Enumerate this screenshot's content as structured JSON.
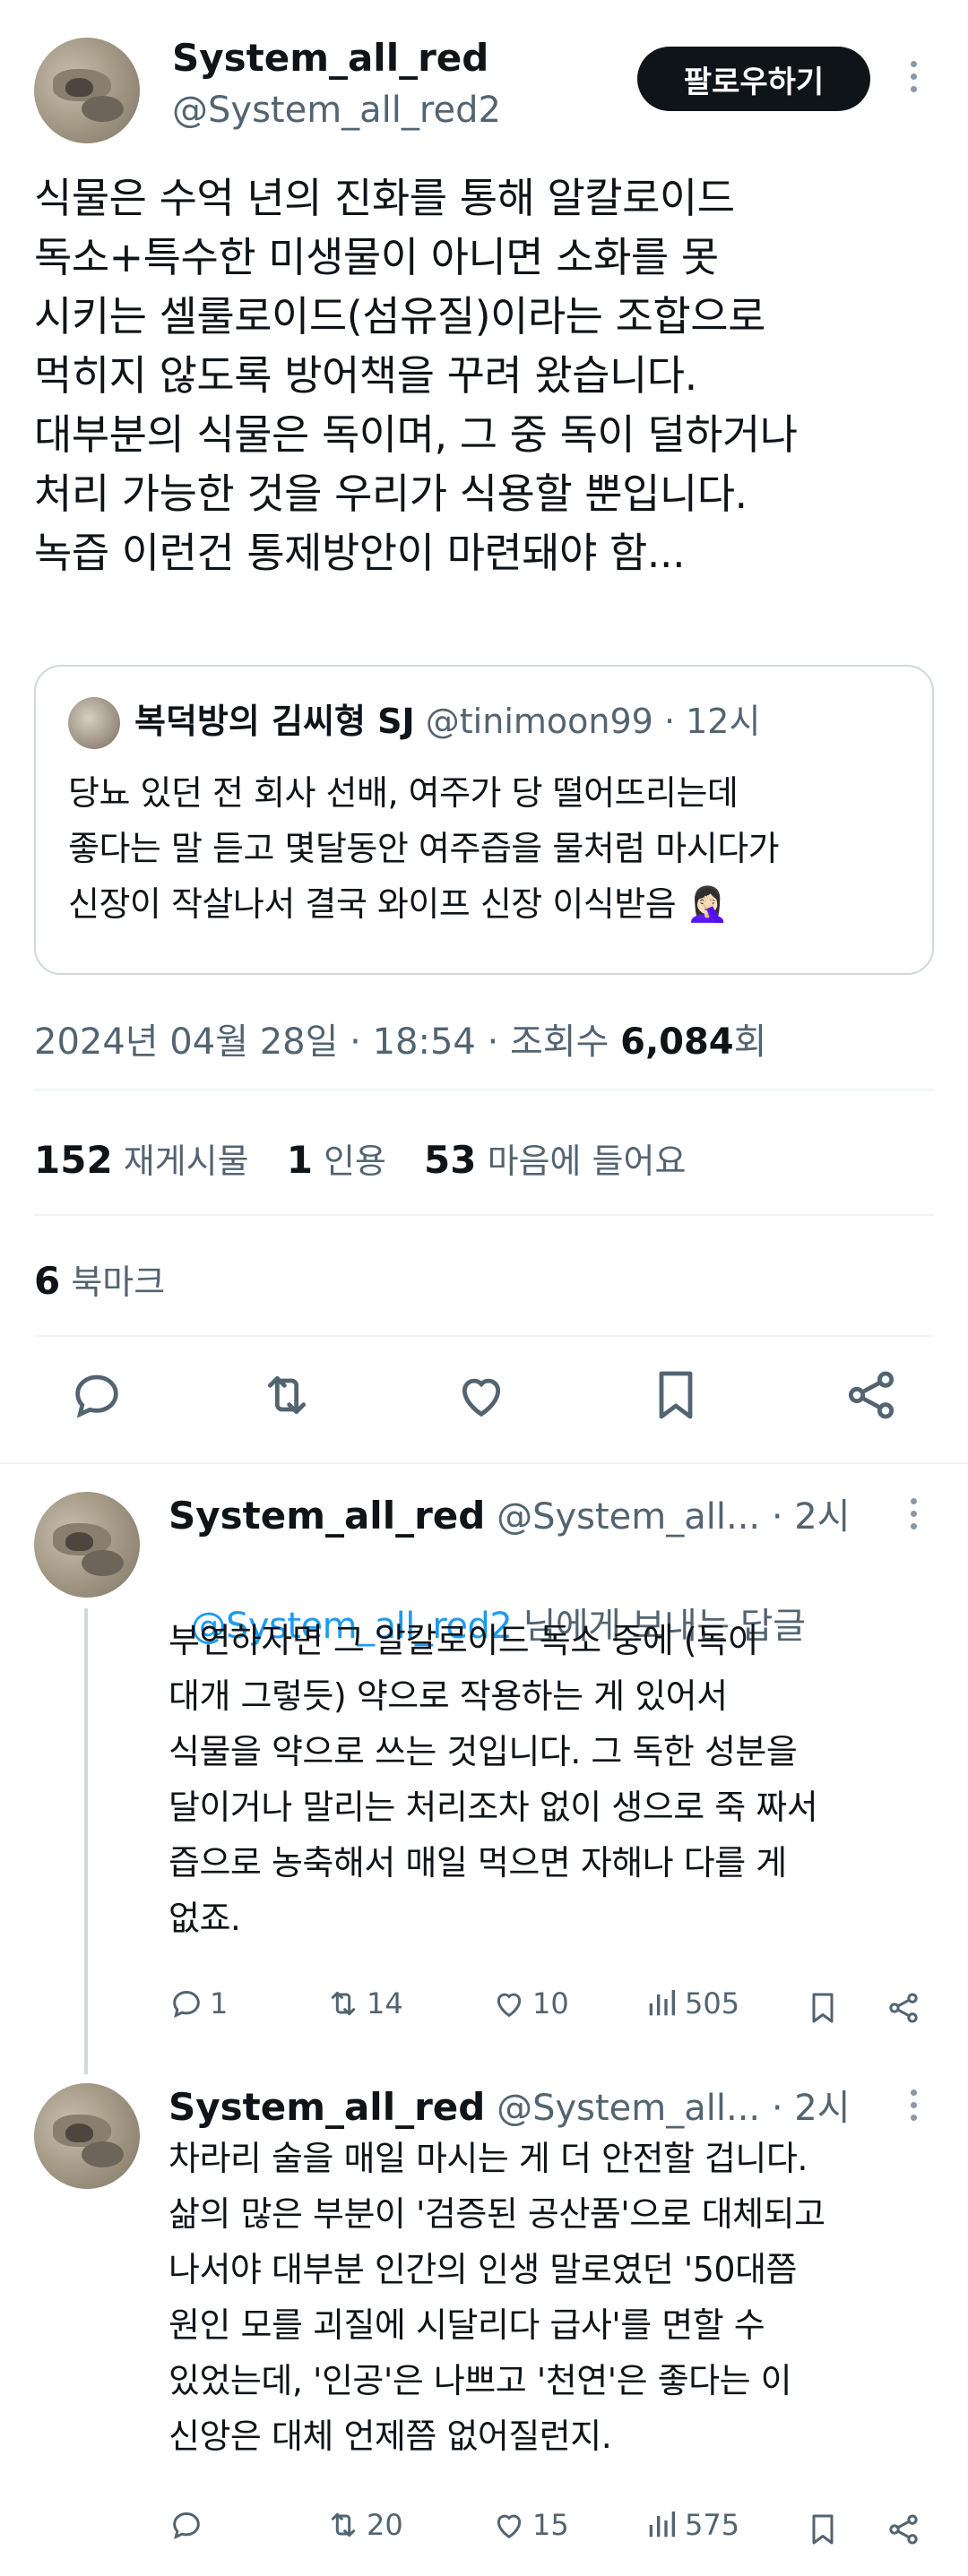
{
  "main": {
    "name": "System_all_red",
    "handle": "@System_all_red2",
    "follow_label": "팔로우하기",
    "text": "식물은 수억 년의 진화를 통해 알칼로이드\n독소+특수한 미생물이 아니면 소화를 못\n시키는 셀룰로이드(섬유질)이라는 조합으로\n먹히지 않도록 방어책을 꾸려 왔습니다.\n대부분의 식물은 독이며, 그 중 독이 덜하거나\n처리 가능한 것을 우리가 식용할 뿐입니다.\n녹즙 이런건 통제방안이 마련돼야 함...",
    "quote": {
      "name": "복덕방의 김씨형 SJ",
      "handle": "@tinimoon99",
      "time": "· 12시",
      "text": "당뇨 있던 전 회사 선배, 여주가 당 떨어뜨리는데\n좋다는 말 듣고 몇달동안 여주즙을 물처럼 마시다가\n신장이 작살나서 결국 와이프 신장 이식받음 🤦🏻‍♀️"
    },
    "date": "2024년 04월 28일 · 18:54 · 조회수 ",
    "views": "6,084",
    "views_suffix": "회",
    "retweets": "152",
    "retweets_label": "재게시물",
    "quotes": "1",
    "quotes_label": "인용",
    "likes": "53",
    "likes_label": "마음에 들어요",
    "bookmarks": "6",
    "bookmarks_label": "북마크"
  },
  "replies": [
    {
      "name": "System_all_red",
      "handle": "@System_all...",
      "time": "· 2시",
      "reply_to_handle": "@System_all_red2",
      "reply_to_suffix": " 님에게 보내는 답글",
      "text": "부연하자면 그 알칼로이드 독소 중에 (독이\n대개 그렇듯) 약으로 작용하는 게 있어서\n식물을 약으로 쓰는 것입니다. 그 독한 성분을\n달이거나 말리는 처리조차 없이 생으로 죽 짜서\n즙으로 농축해서 매일 먹으면 자해나 다를 게\n없죠.",
      "replies_count": "1",
      "retweets_count": "14",
      "likes_count": "10",
      "views_count": "505"
    },
    {
      "name": "System_all_red",
      "handle": "@System_all...",
      "time": "· 2시",
      "text": "차라리 술을 매일 마시는 게 더 안전할 겁니다.\n삶의 많은 부분이 '검증된 공산품'으로 대체되고\n나서야 대부분 인간의 인생 말로였던 '50대쯤\n원인 모를 괴질에 시달리다 급사'를 면할 수\n있었는데, '인공'은 나쁘고 '천연'은 좋다는 이\n신앙은 대체 언제쯤 없어질런지.",
      "replies_count": "",
      "retweets_count": "20",
      "likes_count": "15",
      "views_count": "575"
    }
  ],
  "colors": {
    "text": "#0f1419",
    "muted": "#536471",
    "link": "#1d9bf0",
    "divider": "#eff3f4",
    "button": "#0f1419"
  }
}
